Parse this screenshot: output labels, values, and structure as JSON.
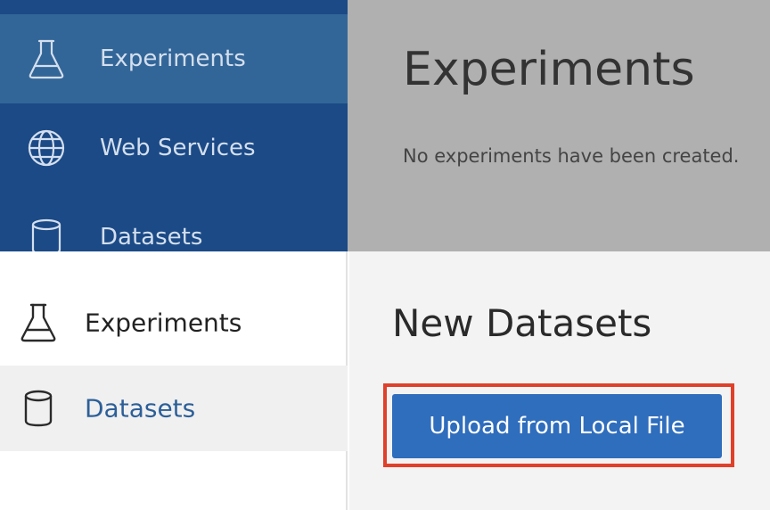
{
  "top_sidebar": {
    "items": [
      {
        "label": "Experiments",
        "icon": "flask-icon",
        "active": true
      },
      {
        "label": "Web Services",
        "icon": "globe-icon",
        "active": false
      },
      {
        "label": "Datasets",
        "icon": "cylinder-icon",
        "active": false
      }
    ]
  },
  "top_content": {
    "title": "Experiments",
    "message": "No experiments have been created."
  },
  "bottom_sidebar": {
    "items": [
      {
        "label": "Experiments",
        "icon": "flask-icon",
        "active": false
      },
      {
        "label": "Datasets",
        "icon": "cylinder-icon",
        "active": true
      }
    ]
  },
  "bottom_content": {
    "title": "New Datasets",
    "upload_button_label": "Upload from Local File"
  },
  "colors": {
    "sidebar_dark": "#1b4a86",
    "sidebar_active": "#336698",
    "button_blue": "#2f6dbd",
    "highlight_red": "#e0402a"
  }
}
